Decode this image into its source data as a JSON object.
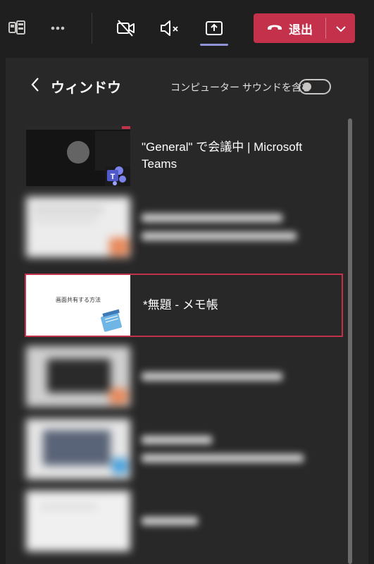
{
  "toolbar": {
    "leave_label": "退出"
  },
  "share_panel": {
    "title": "ウィンドウ",
    "sound_toggle_label": "コンピューター サウンドを含む",
    "sound_toggle_on": false
  },
  "windows": [
    {
      "label": "\"General\" で会議中 | Microsoft Teams",
      "blurred": false,
      "selected": false
    },
    {
      "label": "",
      "blurred": true,
      "selected": false
    },
    {
      "label": "*無題 - メモ帳",
      "thumb_text": "画面共有する方法",
      "blurred": false,
      "selected": true
    },
    {
      "label": "",
      "blurred": true,
      "selected": false
    },
    {
      "label": "",
      "blurred": true,
      "selected": false
    },
    {
      "label": "",
      "blurred": true,
      "selected": false
    }
  ],
  "colors": {
    "background": "#201f1f",
    "panel": "#292828",
    "leave_button": "#c4314b",
    "selection_border": "#c4314b",
    "share_indicator": "#8f94d6"
  }
}
